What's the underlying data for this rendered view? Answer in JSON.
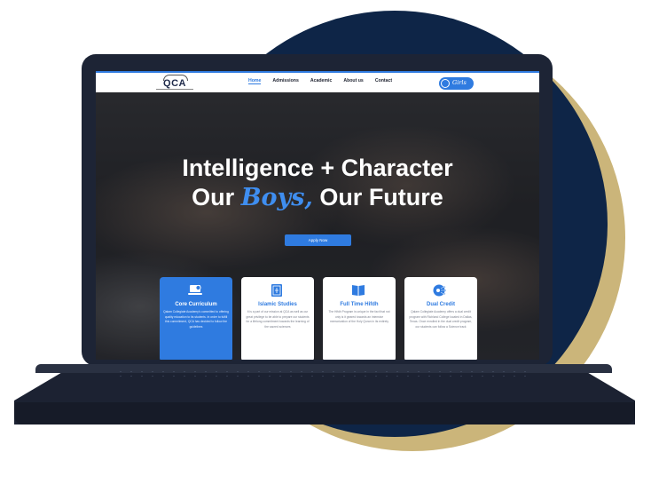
{
  "logo": {
    "text": "QCA"
  },
  "nav": {
    "items": [
      "Home",
      "Admissions",
      "Academic",
      "About us",
      "Contact"
    ],
    "active": "Home"
  },
  "girls_button": {
    "label": "Girls"
  },
  "hero": {
    "line1": "Intelligence + Character",
    "line2_before": "Our ",
    "line2_script": "Boys,",
    "line2_after": " Our Future",
    "apply_label": "Apply Now"
  },
  "cards": [
    {
      "title": "Core Curriculum",
      "text": "Qalam Collegiate Academy's committed to offering quality education to its students. In order to fulfill this commitment, QCA has decided to follow the guidelines",
      "icon": "laptop-check-icon"
    },
    {
      "title": "Islamic Studies",
      "text": "It is a part of our mission at QCA as well as our great privilege to be able to prepare our students for a lifelong commitment towards the learning of the sacred sciences",
      "icon": "quran-book-icon"
    },
    {
      "title": "Full Time Hifdh",
      "text": "The Hifdh Program is unique in the fact that not only is it geared towards an intensive memorization of the Holy Quran in its entirety",
      "icon": "open-book-icon"
    },
    {
      "title": "Dual Credit",
      "text": "Qalam Collegiate Academy offers a dual credit program with Richland College located in Dallas, Texas. Once enrolled in the dual credit program, our students can follow a Science track",
      "icon": "circuit-icon"
    }
  ],
  "colors": {
    "accent": "#2f7be0",
    "navy": "#0e2547",
    "gold": "#cbb57a",
    "laptop": "#1d2435"
  }
}
